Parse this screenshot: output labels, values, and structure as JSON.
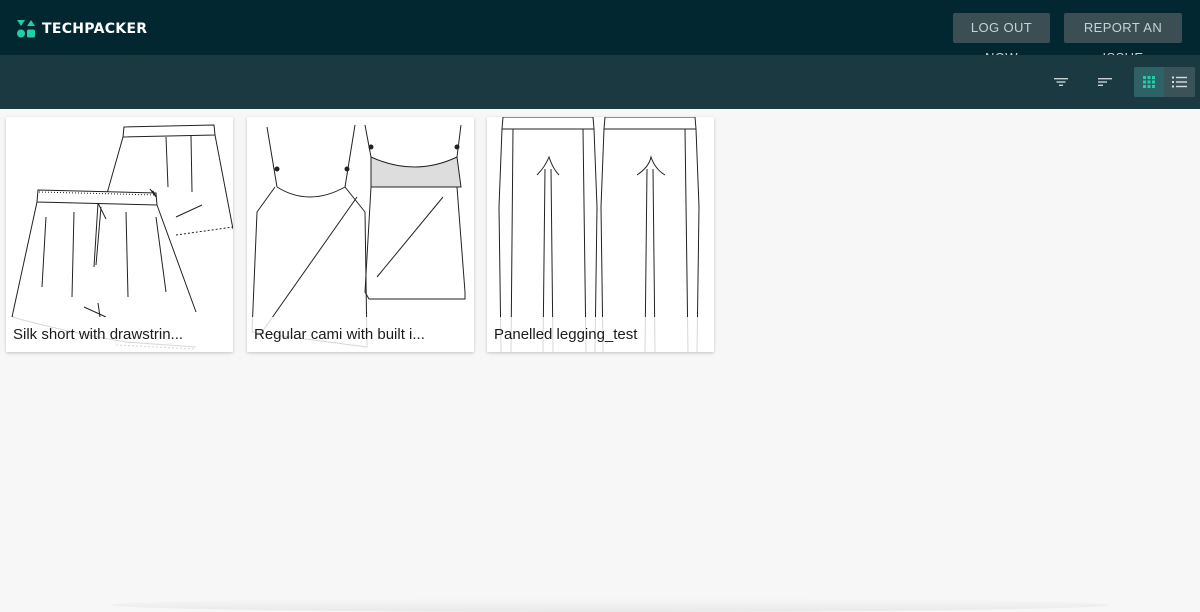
{
  "app": {
    "brand": "TECHPACKER",
    "accent_color": "#1fcfa8",
    "header_bg": "#032730",
    "toolbar_bg": "#1b3940"
  },
  "header": {
    "logout_label": "LOG OUT NOW",
    "report_label": "REPORT AN ISSUE"
  },
  "toolbar": {
    "icons": [
      "filter-icon",
      "sort-icon",
      "grid-view-icon",
      "list-view-icon"
    ],
    "active_view": "grid"
  },
  "products": [
    {
      "title": "Silk short with drawstrin...",
      "sketch": "shorts-icon"
    },
    {
      "title": "Regular cami with built i...",
      "sketch": "cami-icon"
    },
    {
      "title": "Panelled legging_test",
      "sketch": "legging-icon"
    }
  ]
}
